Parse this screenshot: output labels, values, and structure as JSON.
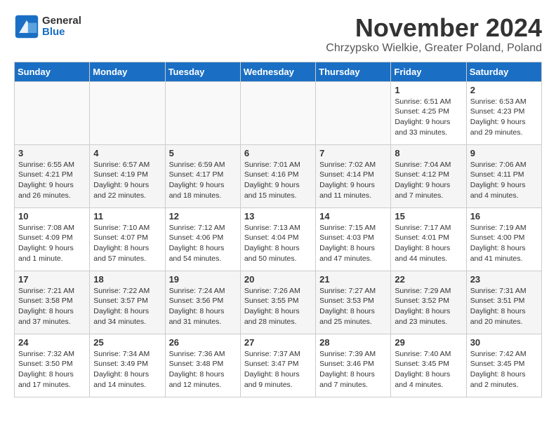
{
  "logo": {
    "general": "General",
    "blue": "Blue"
  },
  "title": "November 2024",
  "location": "Chrzypsko Wielkie, Greater Poland, Poland",
  "days_of_week": [
    "Sunday",
    "Monday",
    "Tuesday",
    "Wednesday",
    "Thursday",
    "Friday",
    "Saturday"
  ],
  "weeks": [
    [
      {
        "day": "",
        "info": ""
      },
      {
        "day": "",
        "info": ""
      },
      {
        "day": "",
        "info": ""
      },
      {
        "day": "",
        "info": ""
      },
      {
        "day": "",
        "info": ""
      },
      {
        "day": "1",
        "info": "Sunrise: 6:51 AM\nSunset: 4:25 PM\nDaylight: 9 hours and 33 minutes."
      },
      {
        "day": "2",
        "info": "Sunrise: 6:53 AM\nSunset: 4:23 PM\nDaylight: 9 hours and 29 minutes."
      }
    ],
    [
      {
        "day": "3",
        "info": "Sunrise: 6:55 AM\nSunset: 4:21 PM\nDaylight: 9 hours and 26 minutes."
      },
      {
        "day": "4",
        "info": "Sunrise: 6:57 AM\nSunset: 4:19 PM\nDaylight: 9 hours and 22 minutes."
      },
      {
        "day": "5",
        "info": "Sunrise: 6:59 AM\nSunset: 4:17 PM\nDaylight: 9 hours and 18 minutes."
      },
      {
        "day": "6",
        "info": "Sunrise: 7:01 AM\nSunset: 4:16 PM\nDaylight: 9 hours and 15 minutes."
      },
      {
        "day": "7",
        "info": "Sunrise: 7:02 AM\nSunset: 4:14 PM\nDaylight: 9 hours and 11 minutes."
      },
      {
        "day": "8",
        "info": "Sunrise: 7:04 AM\nSunset: 4:12 PM\nDaylight: 9 hours and 7 minutes."
      },
      {
        "day": "9",
        "info": "Sunrise: 7:06 AM\nSunset: 4:11 PM\nDaylight: 9 hours and 4 minutes."
      }
    ],
    [
      {
        "day": "10",
        "info": "Sunrise: 7:08 AM\nSunset: 4:09 PM\nDaylight: 9 hours and 1 minute."
      },
      {
        "day": "11",
        "info": "Sunrise: 7:10 AM\nSunset: 4:07 PM\nDaylight: 8 hours and 57 minutes."
      },
      {
        "day": "12",
        "info": "Sunrise: 7:12 AM\nSunset: 4:06 PM\nDaylight: 8 hours and 54 minutes."
      },
      {
        "day": "13",
        "info": "Sunrise: 7:13 AM\nSunset: 4:04 PM\nDaylight: 8 hours and 50 minutes."
      },
      {
        "day": "14",
        "info": "Sunrise: 7:15 AM\nSunset: 4:03 PM\nDaylight: 8 hours and 47 minutes."
      },
      {
        "day": "15",
        "info": "Sunrise: 7:17 AM\nSunset: 4:01 PM\nDaylight: 8 hours and 44 minutes."
      },
      {
        "day": "16",
        "info": "Sunrise: 7:19 AM\nSunset: 4:00 PM\nDaylight: 8 hours and 41 minutes."
      }
    ],
    [
      {
        "day": "17",
        "info": "Sunrise: 7:21 AM\nSunset: 3:58 PM\nDaylight: 8 hours and 37 minutes."
      },
      {
        "day": "18",
        "info": "Sunrise: 7:22 AM\nSunset: 3:57 PM\nDaylight: 8 hours and 34 minutes."
      },
      {
        "day": "19",
        "info": "Sunrise: 7:24 AM\nSunset: 3:56 PM\nDaylight: 8 hours and 31 minutes."
      },
      {
        "day": "20",
        "info": "Sunrise: 7:26 AM\nSunset: 3:55 PM\nDaylight: 8 hours and 28 minutes."
      },
      {
        "day": "21",
        "info": "Sunrise: 7:27 AM\nSunset: 3:53 PM\nDaylight: 8 hours and 25 minutes."
      },
      {
        "day": "22",
        "info": "Sunrise: 7:29 AM\nSunset: 3:52 PM\nDaylight: 8 hours and 23 minutes."
      },
      {
        "day": "23",
        "info": "Sunrise: 7:31 AM\nSunset: 3:51 PM\nDaylight: 8 hours and 20 minutes."
      }
    ],
    [
      {
        "day": "24",
        "info": "Sunrise: 7:32 AM\nSunset: 3:50 PM\nDaylight: 8 hours and 17 minutes."
      },
      {
        "day": "25",
        "info": "Sunrise: 7:34 AM\nSunset: 3:49 PM\nDaylight: 8 hours and 14 minutes."
      },
      {
        "day": "26",
        "info": "Sunrise: 7:36 AM\nSunset: 3:48 PM\nDaylight: 8 hours and 12 minutes."
      },
      {
        "day": "27",
        "info": "Sunrise: 7:37 AM\nSunset: 3:47 PM\nDaylight: 8 hours and 9 minutes."
      },
      {
        "day": "28",
        "info": "Sunrise: 7:39 AM\nSunset: 3:46 PM\nDaylight: 8 hours and 7 minutes."
      },
      {
        "day": "29",
        "info": "Sunrise: 7:40 AM\nSunset: 3:45 PM\nDaylight: 8 hours and 4 minutes."
      },
      {
        "day": "30",
        "info": "Sunrise: 7:42 AM\nSunset: 3:45 PM\nDaylight: 8 hours and 2 minutes."
      }
    ]
  ]
}
